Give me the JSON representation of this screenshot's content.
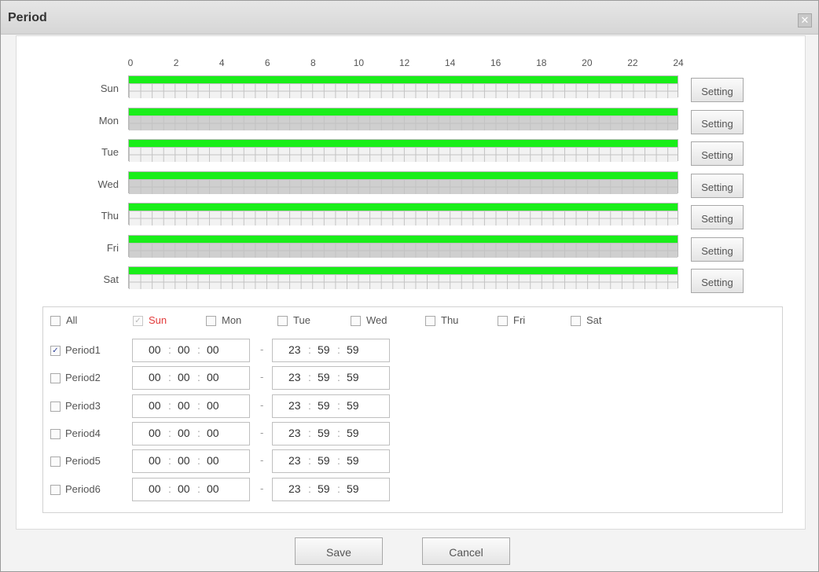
{
  "dialog": {
    "title": "Period",
    "close_icon": "close-icon"
  },
  "timeline": {
    "hours": [
      "0",
      "2",
      "4",
      "6",
      "8",
      "10",
      "12",
      "14",
      "16",
      "18",
      "20",
      "22",
      "24"
    ],
    "days": [
      {
        "label": "Sun",
        "shade": "light",
        "setting": "Setting"
      },
      {
        "label": "Mon",
        "shade": "dark",
        "setting": "Setting"
      },
      {
        "label": "Tue",
        "shade": "light",
        "setting": "Setting"
      },
      {
        "label": "Wed",
        "shade": "dark",
        "setting": "Setting"
      },
      {
        "label": "Thu",
        "shade": "light",
        "setting": "Setting"
      },
      {
        "label": "Fri",
        "shade": "dark",
        "setting": "Setting"
      },
      {
        "label": "Sat",
        "shade": "light",
        "setting": "Setting"
      }
    ],
    "active_color": "#19ee19"
  },
  "day_checks": [
    {
      "label": "All",
      "checked": false,
      "highlight": false
    },
    {
      "label": "Sun",
      "checked": true,
      "highlight": true
    },
    {
      "label": "Mon",
      "checked": false,
      "highlight": false
    },
    {
      "label": "Tue",
      "checked": false,
      "highlight": false
    },
    {
      "label": "Wed",
      "checked": false,
      "highlight": false
    },
    {
      "label": "Thu",
      "checked": false,
      "highlight": false
    },
    {
      "label": "Fri",
      "checked": false,
      "highlight": false
    },
    {
      "label": "Sat",
      "checked": false,
      "highlight": false
    }
  ],
  "periods": [
    {
      "label": "Period1",
      "checked": true,
      "start": [
        "00",
        "00",
        "00"
      ],
      "end": [
        "23",
        "59",
        "59"
      ]
    },
    {
      "label": "Period2",
      "checked": false,
      "start": [
        "00",
        "00",
        "00"
      ],
      "end": [
        "23",
        "59",
        "59"
      ]
    },
    {
      "label": "Period3",
      "checked": false,
      "start": [
        "00",
        "00",
        "00"
      ],
      "end": [
        "23",
        "59",
        "59"
      ]
    },
    {
      "label": "Period4",
      "checked": false,
      "start": [
        "00",
        "00",
        "00"
      ],
      "end": [
        "23",
        "59",
        "59"
      ]
    },
    {
      "label": "Period5",
      "checked": false,
      "start": [
        "00",
        "00",
        "00"
      ],
      "end": [
        "23",
        "59",
        "59"
      ]
    },
    {
      "label": "Period6",
      "checked": false,
      "start": [
        "00",
        "00",
        "00"
      ],
      "end": [
        "23",
        "59",
        "59"
      ]
    }
  ],
  "separators": {
    "time": ":",
    "range": "-",
    "check_mark": "✓"
  },
  "footer": {
    "save_label": "Save",
    "cancel_label": "Cancel"
  }
}
